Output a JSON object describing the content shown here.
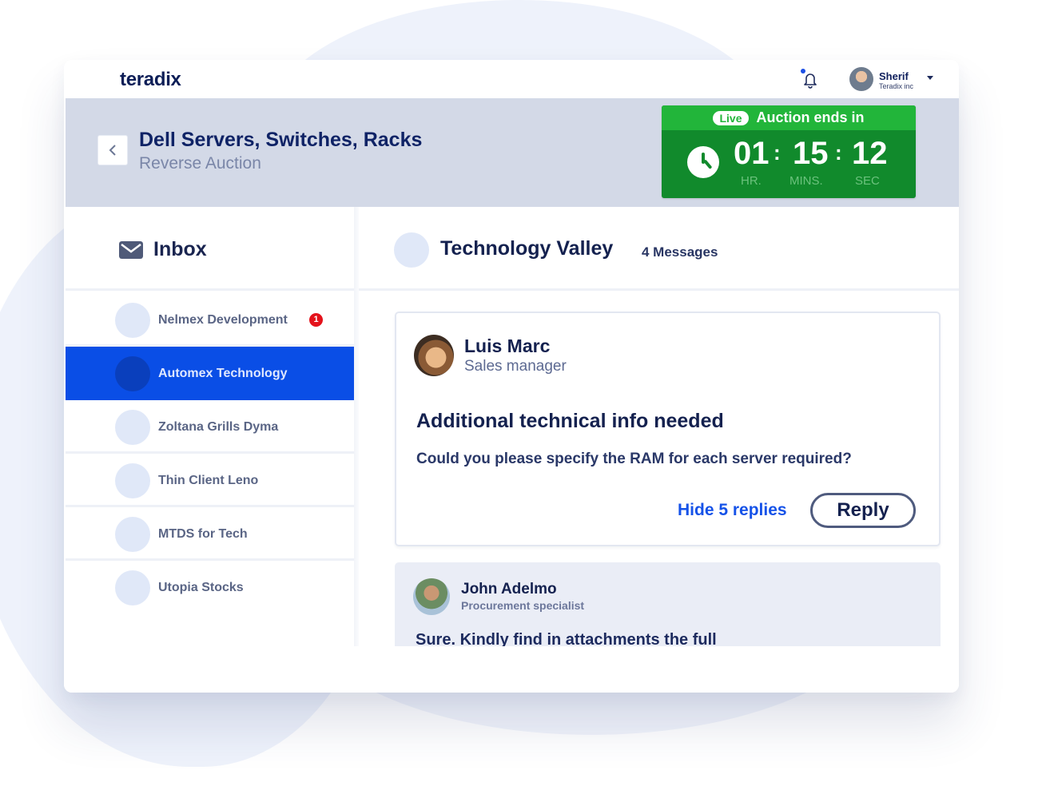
{
  "app": {
    "logo": "teradix",
    "notifications": {
      "icon": "bell-icon",
      "has_unread": true
    },
    "user": {
      "name": "Sherif",
      "org": "Teradix inc",
      "avatar_icon": "user-avatar",
      "menu_icon": "caret-down-icon"
    }
  },
  "auction": {
    "back_icon": "chevron-left-icon",
    "title": "Dell Servers, Switches, Racks",
    "subtitle": "Reverse Auction",
    "timer": {
      "live_label": "Live",
      "heading": "Auction ends in",
      "icon": "clock-icon",
      "hours": "01",
      "minutes": "15",
      "seconds": "12",
      "separator": ":",
      "hours_label": "HR.",
      "minutes_label": "MINS.",
      "seconds_label": "SEC",
      "colors": {
        "header": "#22b53a",
        "body": "#118a2c"
      }
    }
  },
  "inbox": {
    "icon": "mail-icon",
    "title": "Inbox",
    "conversations": [
      {
        "name": "Nelmex Development",
        "unread": "1",
        "active": false
      },
      {
        "name": "Automex Technology",
        "active": true
      },
      {
        "name": "Zoltana Grills Dyma",
        "active": false
      },
      {
        "name": "Thin Client Leno",
        "active": false
      },
      {
        "name": "MTDS for Tech",
        "active": false
      },
      {
        "name": "Utopia Stocks",
        "active": false
      }
    ],
    "active_color": "#0a4ee6"
  },
  "thread": {
    "name": "Technology Valley",
    "count": "4 Messages",
    "message": {
      "author": "Luis Marc",
      "role": "Sales manager",
      "subject": "Additional technical info needed",
      "body": "Could you please specify the RAM for each server required?",
      "hide_replies": "Hide 5 replies",
      "reply_label": "Reply"
    },
    "reply": {
      "author": "John Adelmo",
      "role": "Procurement specialist",
      "body": "Sure. Kindly find in attachments the full"
    }
  }
}
